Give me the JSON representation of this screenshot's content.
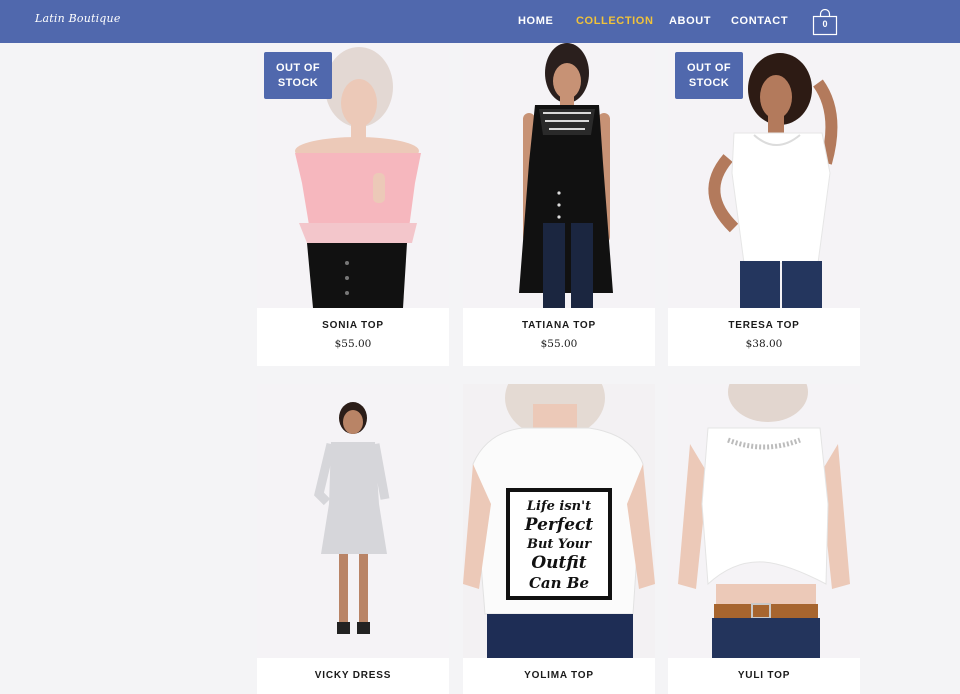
{
  "header": {
    "logo_text": "Latin Boutique",
    "nav": [
      {
        "label": "HOME",
        "active": false
      },
      {
        "label": "COLLECTION",
        "active": true
      },
      {
        "label": "ABOUT",
        "active": false
      },
      {
        "label": "CONTACT",
        "active": false
      }
    ],
    "cart_count": "0",
    "colors": {
      "bar": "#5068ad",
      "active_link": "#f0c23a"
    }
  },
  "products": [
    {
      "name": "SONIA TOP",
      "price": "$55.00",
      "badge": "OUT OF STOCK",
      "badge_line1": "OUT OF",
      "badge_line2": "STOCK"
    },
    {
      "name": "TATIANA TOP",
      "price": "$55.00",
      "badge": ""
    },
    {
      "name": "TERESA TOP",
      "price": "$38.00",
      "badge": "OUT OF STOCK",
      "badge_line1": "OUT OF",
      "badge_line2": "STOCK"
    },
    {
      "name": "VICKY DRESS",
      "price": "",
      "badge": ""
    },
    {
      "name": "YOLIMA TOP",
      "price": "",
      "badge": "",
      "shirt_text": [
        "Life isn't",
        "Perfect",
        "But Your",
        "Outfit",
        "Can Be"
      ]
    },
    {
      "name": "YULI TOP",
      "price": "",
      "badge": ""
    }
  ]
}
